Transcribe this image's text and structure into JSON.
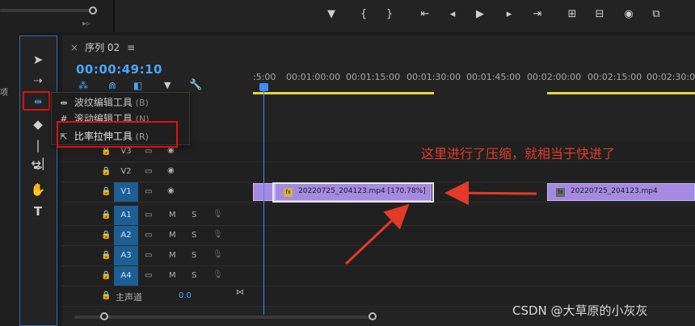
{
  "toolbar_top": {
    "transport_icons": [
      "marker-icon",
      "in-point-icon",
      "out-point-icon",
      "go-to-in-icon",
      "step-back-icon",
      "play-icon",
      "step-forward-icon",
      "go-to-out-icon",
      "lift-icon",
      "extract-icon",
      "export-frame-icon",
      "compare-icon"
    ]
  },
  "tools": [
    "selection-tool",
    "track-select-tool",
    "ripple-edit-tool",
    "razor-tool",
    "slip-tool",
    "pen-tool",
    "hand-tool",
    "type-tool"
  ],
  "left_panel_label": "项",
  "menu": {
    "items": [
      {
        "label": "波纹编辑工具",
        "shortcut": "(B)"
      },
      {
        "label": "滚动编辑工具",
        "shortcut": "(N)"
      },
      {
        "label": "比率拉伸工具",
        "shortcut": "(R)"
      }
    ]
  },
  "sequence": {
    "tab_close": "×",
    "tab_label": "序列 02",
    "tab_menu": "≡",
    "timecode": "00:00:49:10"
  },
  "ruler": {
    "labels": [
      ":5:00",
      "00:01:00:00",
      "00:01:15:00",
      "00:01:30:00",
      "00:01:45:00",
      "00:02:00:00",
      "00:02:15:00",
      "00:02:30:00"
    ]
  },
  "tracks": {
    "video": [
      {
        "name": "V3",
        "active": false
      },
      {
        "name": "V2",
        "active": false
      },
      {
        "name": "V1",
        "active": true
      }
    ],
    "audio": [
      {
        "name": "A1",
        "m": "M",
        "s": "S"
      },
      {
        "name": "A2",
        "m": "M",
        "s": "S"
      },
      {
        "name": "A3",
        "m": "M",
        "s": "S"
      },
      {
        "name": "A4",
        "m": "M",
        "s": "S"
      }
    ],
    "master": {
      "label": "主声道",
      "value": "0.0"
    }
  },
  "clips": [
    {
      "label": "20220725_204123.mp4 [170.78%]",
      "fx": "fx"
    },
    {
      "label": "20220725_204123.mp4",
      "fx": "fx"
    }
  ],
  "annotation": "这里进行了压缩，就相当于快进了",
  "watermark": "CSDN @大草原的小灰灰",
  "colors": {
    "accent_blue": "#2f6fb5",
    "clip_purple": "#a48ae0",
    "highlight_red": "#e01010",
    "ruler_yellow": "#e6d63a"
  }
}
